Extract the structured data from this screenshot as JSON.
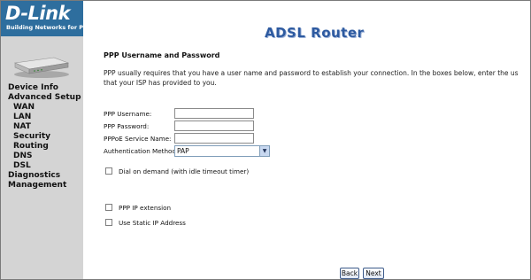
{
  "brand": {
    "logo": "D-Link",
    "tagline": "Building Networks for People"
  },
  "header": {
    "title": "ADSL Router"
  },
  "sidebar": {
    "items": [
      {
        "label": "Device Info",
        "level": 0
      },
      {
        "label": "Advanced Setup",
        "level": 0
      },
      {
        "label": "WAN",
        "level": 1
      },
      {
        "label": "LAN",
        "level": 1
      },
      {
        "label": "NAT",
        "level": 1
      },
      {
        "label": "Security",
        "level": 1
      },
      {
        "label": "Routing",
        "level": 1
      },
      {
        "label": "DNS",
        "level": 1
      },
      {
        "label": "DSL",
        "level": 1
      },
      {
        "label": "Diagnostics",
        "level": 0
      },
      {
        "label": "Management",
        "level": 0
      }
    ]
  },
  "main": {
    "section_title": "PPP Username and Password",
    "description_line1": "PPP usually requires that you have a user name and password to establish your connection. In the boxes below, enter the us",
    "description_line2": "that your ISP has provided to you.",
    "fields": {
      "username_label": "PPP Username:",
      "username_value": "",
      "password_label": "PPP Password:",
      "password_value": "",
      "service_label": "PPPoE Service Name:",
      "service_value": "",
      "auth_label": "Authentication Method:",
      "auth_value": "PAP"
    },
    "checkboxes": {
      "dial_on_demand": {
        "label": "Dial on demand (with idle timeout timer)",
        "checked": false
      },
      "ppp_ip_extension": {
        "label": "PPP IP extension",
        "checked": false
      },
      "static_ip": {
        "label": "Use Static IP Address",
        "checked": false
      }
    },
    "buttons": {
      "back": "Back",
      "next": "Next"
    }
  }
}
